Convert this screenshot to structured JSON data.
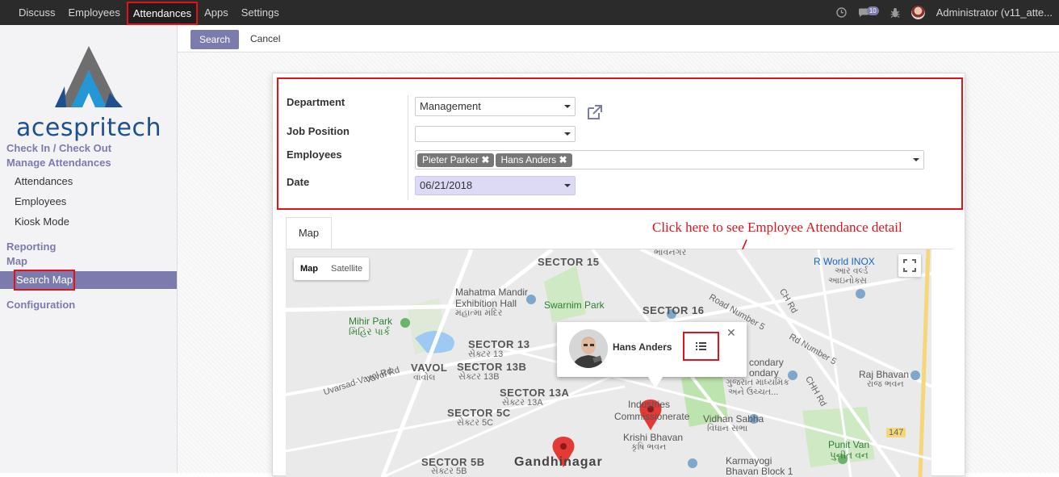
{
  "navbar": {
    "menu": [
      "Discuss",
      "Employees",
      "Attendances",
      "Apps",
      "Settings"
    ],
    "active_index": 2,
    "message_count": "10",
    "user": "Administrator (v11_atte..."
  },
  "sidebar": {
    "brand": "acespritech",
    "sections": [
      {
        "label": "Check In / Check Out"
      },
      {
        "label": "Manage Attendances"
      },
      {
        "label": "Attendances"
      },
      {
        "label": "Employees"
      },
      {
        "label": "Kiosk Mode"
      },
      {
        "label": "Reporting"
      },
      {
        "label": "Map"
      },
      {
        "label": "Search Map"
      },
      {
        "label": "Configuration"
      }
    ]
  },
  "control": {
    "search_label": "Search",
    "cancel_label": "Cancel"
  },
  "form": {
    "department_label": "Department",
    "department_value": "Management",
    "job_position_label": "Job Position",
    "job_position_value": "",
    "employees_label": "Employees",
    "employees": [
      "Pieter Parker",
      "Hans Anders"
    ],
    "date_label": "Date",
    "date_value": "06/21/2018"
  },
  "tabs": {
    "map": "Map"
  },
  "annotation": "Click here to see Employee Attendance detail",
  "map": {
    "type_map": "Map",
    "type_satellite": "Satellite",
    "popup_name": "Hans Anders",
    "labels": [
      {
        "t": "SECTOR 15",
        "c": "sector"
      },
      {
        "t": "Mahatma Mandir",
        "c": "place"
      },
      {
        "t": "Exhibition Hall",
        "c": "place"
      },
      {
        "t": "મહાત્મા મંદિર",
        "c": "sub"
      },
      {
        "t": "Swarnim Park",
        "c": "green"
      },
      {
        "t": "SECTOR 16",
        "c": "sector"
      },
      {
        "t": "R World INOX",
        "c": "blue"
      },
      {
        "t": "આર વર્લ્ડ",
        "c": "sub"
      },
      {
        "t": "આઇનોક્સ",
        "c": "sub"
      },
      {
        "t": "Mihir Park",
        "c": "green"
      },
      {
        "t": "મિહિર પાર્ક",
        "c": "green"
      },
      {
        "t": "SECTOR 13",
        "c": "sector"
      },
      {
        "t": "સેક્ટર 13",
        "c": "sub"
      },
      {
        "t": "VAVOL",
        "c": "sector"
      },
      {
        "t": "વાવોલ",
        "c": "sub"
      },
      {
        "t": "SECTOR 13B",
        "c": "sector"
      },
      {
        "t": "સેક્ટર 13B",
        "c": "sub"
      },
      {
        "t": "SECTOR 13A",
        "c": "sector"
      },
      {
        "t": "સેક્ટર 13A",
        "c": "sub"
      },
      {
        "t": "SECTOR 5C",
        "c": "sector"
      },
      {
        "t": "સેક્ટર 5C",
        "c": "sub"
      },
      {
        "t": "SECTOR 5B",
        "c": "sector"
      },
      {
        "t": "સેક્ટર 5B",
        "c": "sub"
      },
      {
        "t": "Gandhinagar",
        "c": "big"
      },
      {
        "t": "Industries",
        "c": "place"
      },
      {
        "t": "Commissionerate",
        "c": "place"
      },
      {
        "t": "Vidhan Sabha",
        "c": "place"
      },
      {
        "t": "વિધાન સભા",
        "c": "sub"
      },
      {
        "t": "Krishi Bhavan",
        "c": "place"
      },
      {
        "t": "કૃષિ ભવન",
        "c": "sub"
      },
      {
        "t": "Karmayogi",
        "c": "place"
      },
      {
        "t": "Bhavan Block 1",
        "c": "place"
      },
      {
        "t": "condary",
        "c": "place"
      },
      {
        "t": "ondary",
        "c": "place"
      },
      {
        "t": "ગુજરાત માધ્યમિક",
        "c": "sub"
      },
      {
        "t": "અને ઉચ્ચત...",
        "c": "sub"
      },
      {
        "t": "Raj Bhavan",
        "c": "place"
      },
      {
        "t": "રાજ ભવન",
        "c": "sub"
      },
      {
        "t": "Punit Van",
        "c": "green"
      },
      {
        "t": "પુનીત વન",
        "c": "green"
      },
      {
        "t": "ભાવનગર",
        "c": "sub"
      },
      {
        "t": "Uvarsad-Vavol Rd",
        "c": "sub"
      },
      {
        "t": "Vavol Rd",
        "c": "sub"
      },
      {
        "t": "CH Rd",
        "c": "sub"
      },
      {
        "t": "CHH Rd",
        "c": "sub"
      },
      {
        "t": "Road Number 5",
        "c": "sub"
      },
      {
        "t": "Rd Number 5",
        "c": "sub"
      },
      {
        "t": "147",
        "c": "sub"
      }
    ]
  }
}
